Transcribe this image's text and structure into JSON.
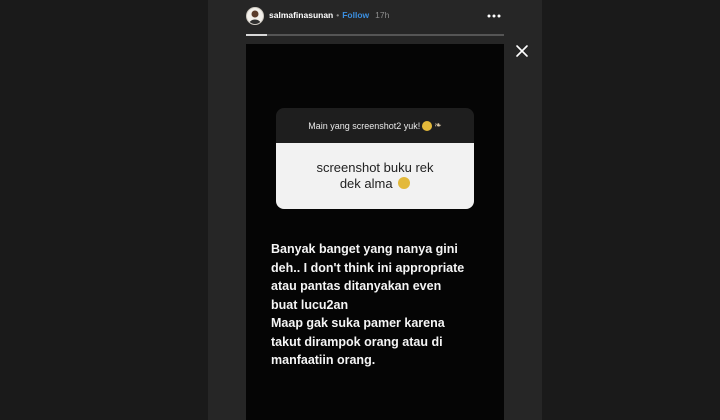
{
  "post": {
    "username": "salmafinasunan",
    "separator": "•",
    "follow_label": "Follow",
    "time": "17h",
    "story_progress": 0.08
  },
  "story": {
    "question": "Main yang screenshot2 yuk!",
    "answer_lines": [
      "screenshot buku rek",
      "dek alma"
    ],
    "caption_lines": [
      "Banyak banget yang nanya gini",
      "deh.. I don't think ini appropriate",
      "atau pantas ditanyakan even",
      "buat lucu2an",
      "Maap gak suka pamer karena",
      "takut dirampok orang atau di",
      "manfaatiin orang."
    ]
  },
  "icons": {
    "more": "more-options-icon",
    "close": "close-icon"
  },
  "colors": {
    "follow": "#3b8fe0",
    "story_bg": "#050505",
    "panel_bg": "#262626"
  }
}
